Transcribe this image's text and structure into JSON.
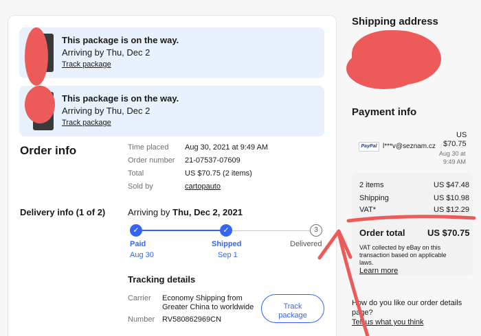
{
  "packages": [
    {
      "status": "This package is on the way.",
      "arriving": "Arriving by Thu, Dec 2",
      "track_link": "Track package"
    },
    {
      "status": "This package is on the way.",
      "arriving": "Arriving by Thu, Dec 2",
      "track_link": "Track package"
    }
  ],
  "order_info": {
    "heading": "Order info",
    "rows": [
      {
        "label": "Time placed",
        "value": "Aug 30, 2021 at 9:49 AM"
      },
      {
        "label": "Order number",
        "value": "21-07537-07609"
      },
      {
        "label": "Total",
        "value": "US $70.75 (2 items)"
      },
      {
        "label": "Sold by",
        "value": "cartopauto"
      }
    ]
  },
  "delivery": {
    "heading": "Delivery info (1 of 2)",
    "arriving_prefix": "Arriving by",
    "arriving_date": "Thu, Dec 2, 2021",
    "steps": [
      {
        "label": "Paid",
        "date": "Aug 30",
        "done": true,
        "marker": "✓"
      },
      {
        "label": "Shipped",
        "date": "Sep 1",
        "done": true,
        "marker": "✓"
      },
      {
        "label": "Delivered",
        "date": "",
        "done": false,
        "marker": "3"
      }
    ],
    "tracking": {
      "heading": "Tracking details",
      "carrier_label": "Carrier",
      "carrier_line1": "Economy Shipping from",
      "carrier_line2": "Greater China to worldwide",
      "number_label": "Number",
      "number_value": "RV580862969CN",
      "button_line1": "Track",
      "button_line2": "package"
    }
  },
  "shipping": {
    "heading": "Shipping address"
  },
  "payment": {
    "heading": "Payment info",
    "method": "PayPal",
    "email": "l***v@seznam.cz",
    "amount_currency": "US",
    "amount": "$70.75",
    "date_line1": "Aug 30 at",
    "date_line2": "9:49 AM",
    "summary": [
      {
        "label": "2 items",
        "value": "US $47.48"
      },
      {
        "label": "Shipping",
        "value": "US $10.98"
      },
      {
        "label": "VAT*",
        "value": "US $12.29"
      }
    ],
    "total_label": "Order total",
    "total_value": "US $70.75",
    "vat_note_1": "VAT collected by eBay on this",
    "vat_note_2": "transaction based on applicable",
    "vat_note_3": "laws.",
    "learn_more": "Learn more"
  },
  "feedback": {
    "question_1": "How do you like our order details",
    "question_2": "page?",
    "link": "Tell us what you think"
  },
  "colors": {
    "accent": "#3665f3",
    "banner": "#e8f1fc",
    "annotation": "#ec5a5a"
  }
}
